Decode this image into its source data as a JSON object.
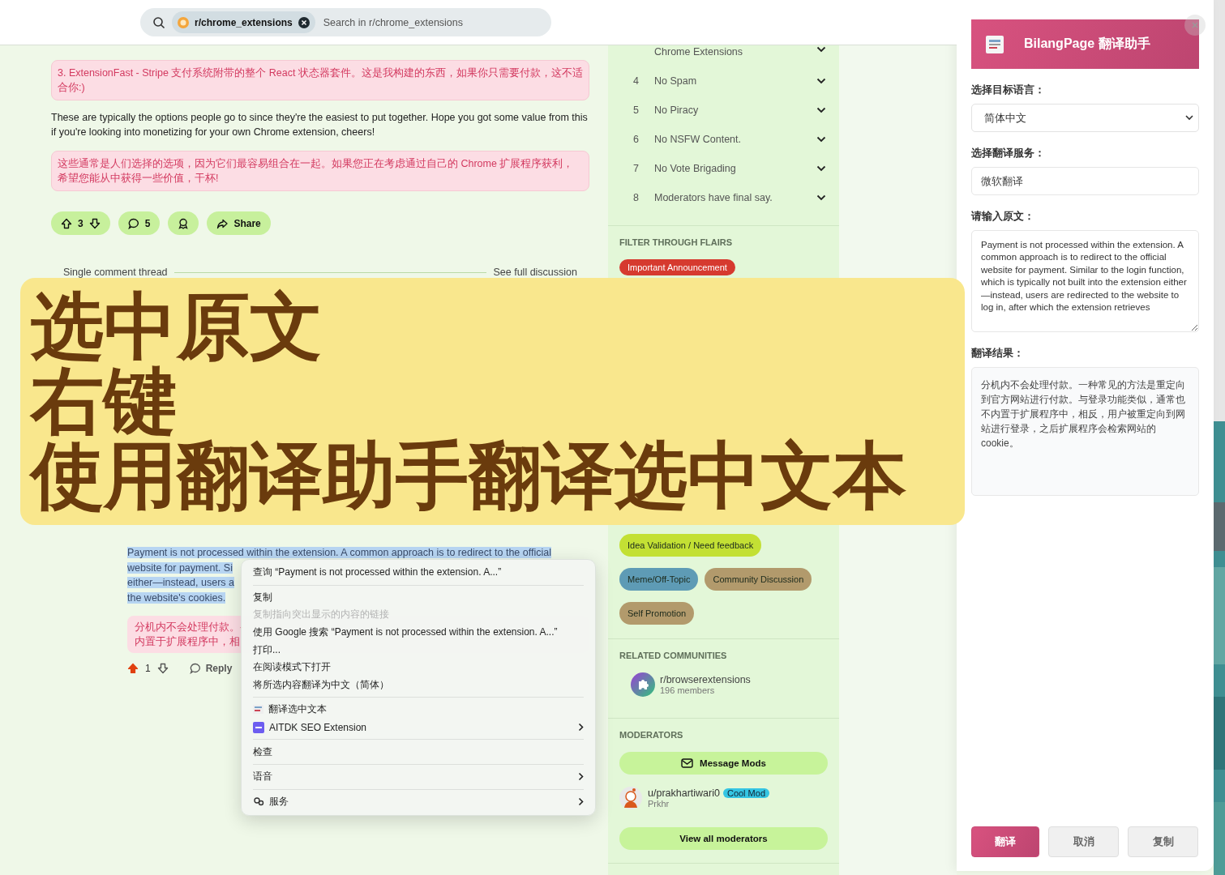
{
  "header": {
    "search": {
      "community": "r/chrome_extensions",
      "placeholder": "Search in r/chrome_extensions"
    }
  },
  "post": {
    "blocks": [
      {
        "kind": "translation",
        "text": "3. ExtensionFast - Stripe 支付系统附带的整个 React 状态器套件。这是我构建的东西，如果你只需要付款，这不适合你:)"
      },
      {
        "kind": "paragraph",
        "text": "These are typically the options people go to since they're the easiest to put together. Hope you got some value from this if you're looking into monetizing for your own Chrome extension, cheers!"
      },
      {
        "kind": "translation",
        "text": "这些通常是人们选择的选项，因为它们最容易组合在一起。如果您正在考虑通过自己的 Chrome 扩展程序获利，希望您能从中获得一些价值，干杯!"
      }
    ],
    "actions": {
      "votes": "3",
      "comments": "5",
      "share": "Share"
    },
    "thread": {
      "label": "Single comment thread",
      "link": "See full discussion"
    }
  },
  "comment": {
    "text_lines": [
      "Payment is not processed within the extension. A common approach is to redirect to the official",
      "website for payment. Si",
      "either—instead, users a",
      "the website's cookies."
    ],
    "translation_lines": [
      "分机内不会处理付款。-",
      "内置于扩展程序中，相"
    ],
    "upvoted": true,
    "votes": "1",
    "reply": "Reply"
  },
  "context_menu": {
    "groups": [
      [
        {
          "kind": "text",
          "label": "查询 “Payment is not processed within the extension. A...”",
          "disabled": false,
          "submenu": false
        }
      ],
      [
        {
          "kind": "text",
          "label": "复制",
          "disabled": false,
          "submenu": false
        },
        {
          "kind": "text",
          "label": "复制指向突出显示的内容的链接",
          "disabled": true,
          "submenu": false
        },
        {
          "kind": "text",
          "label": "使用 Google 搜索 “Payment is not processed within the extension. A...”",
          "disabled": false,
          "submenu": false
        },
        {
          "kind": "text",
          "label": "打印...",
          "disabled": false,
          "submenu": false
        },
        {
          "kind": "text",
          "label": "在阅读模式下打开",
          "disabled": false,
          "submenu": false
        },
        {
          "kind": "text",
          "label": "将所选内容翻译为中文（简体）",
          "disabled": false,
          "submenu": false
        }
      ],
      [
        {
          "kind": "translator",
          "label": "翻译选中文本",
          "disabled": false,
          "submenu": false
        },
        {
          "kind": "aitdk",
          "label": "AITDK SEO Extension",
          "disabled": false,
          "submenu": true
        }
      ],
      [
        {
          "kind": "text",
          "label": "检查",
          "disabled": false,
          "submenu": false
        }
      ],
      [
        {
          "kind": "text",
          "label": "语音",
          "disabled": false,
          "submenu": true
        }
      ],
      [
        {
          "kind": "services",
          "label": "服务",
          "disabled": false,
          "submenu": true
        }
      ]
    ]
  },
  "sidebar": {
    "rules": [
      {
        "title": "Chrome Extensions"
      },
      {
        "number": "4",
        "title": "No Spam"
      },
      {
        "number": "5",
        "title": "No Piracy"
      },
      {
        "number": "6",
        "title": "No NSFW Content."
      },
      {
        "number": "7",
        "title": "No Vote Brigading"
      },
      {
        "number": "8",
        "title": "Moderators have final say."
      }
    ],
    "flairs_title": "FILTER THROUGH FLAIRS",
    "flair_groups": [
      [
        {
          "label": "Important Announcement",
          "color": "#d63a2f"
        }
      ],
      [
        {
          "label": "Idea Validation / Need feedback",
          "color": "#c3e034"
        }
      ],
      [
        {
          "label": "Meme/Off-Topic",
          "color": "#5e9bb5"
        },
        {
          "label": "Community Discussion",
          "color": "#b29a6c"
        }
      ],
      [
        {
          "label": "Self Promotion",
          "color": "#b29a6c"
        }
      ]
    ],
    "related": {
      "title": "RELATED COMMUNITIES",
      "communities": [
        {
          "name": "r/browserextensions",
          "members": "196 members"
        }
      ]
    },
    "moderators": {
      "title": "MODERATORS",
      "message_button": "Message Mods",
      "list": [
        {
          "name": "u/prakhartiwari0",
          "badge": "Cool Mod",
          "display": "Prkhr"
        }
      ],
      "view_all": "View all moderators"
    }
  },
  "translator": {
    "title": "BilangPage 翻译助手",
    "language_label": "选择目标语言：",
    "language": "简体中文",
    "service_label": "选择翻译服务：",
    "service": "微软翻译",
    "source_label": "请输入原文：",
    "source": "Payment is not processed within the extension. A common approach is to redirect to the official website for payment. Similar to the login function, which is typically not built into the extension either—instead, users are redirected to the website to log in, after which the extension retrieves",
    "result_label": "翻译结果：",
    "result": "分机内不会处理付款。一种常见的方法是重定向到官方网站进行付款。与登录功能类似，通常也不内置于扩展程序中，相反，用户被重定向到网站进行登录，之后扩展程序会检索网站的 cookie。",
    "buttons": [
      {
        "label": "翻译",
        "primary": true
      },
      {
        "label": "取消",
        "primary": false
      },
      {
        "label": "复制",
        "primary": false
      }
    ]
  },
  "caption": {
    "lines": [
      "选中原文",
      "右键",
      "使用翻译助手翻译选中文本"
    ]
  }
}
